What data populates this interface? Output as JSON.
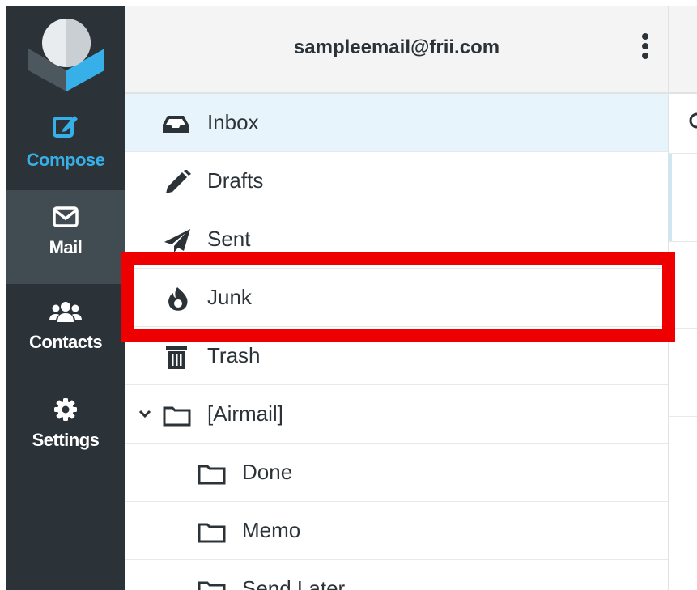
{
  "nav": {
    "compose": {
      "label": "Compose",
      "icon": "compose-icon"
    },
    "mail": {
      "label": "Mail",
      "icon": "envelope-icon"
    },
    "contacts": {
      "label": "Contacts",
      "icon": "users-icon"
    },
    "settings": {
      "label": "Settings",
      "icon": "gear-icon"
    }
  },
  "header": {
    "account": "sampleemail@frii.com",
    "menu_icon": "kebab-menu-icon"
  },
  "folders": [
    {
      "name": "Inbox",
      "icon": "inbox-icon",
      "active": true
    },
    {
      "name": "Drafts",
      "icon": "pencil-icon"
    },
    {
      "name": "Sent",
      "icon": "paper-plane-icon"
    },
    {
      "name": "Junk",
      "icon": "fire-icon"
    },
    {
      "name": "Trash",
      "icon": "trash-icon"
    },
    {
      "name": "[Airmail]",
      "icon": "folder-icon",
      "expanded": true
    },
    {
      "name": "Done",
      "icon": "folder-icon"
    },
    {
      "name": "Memo",
      "icon": "folder-icon"
    },
    {
      "name": "Send Later",
      "icon": "folder-icon"
    }
  ],
  "colors": {
    "nav_bg": "#2c3338",
    "nav_active_bg": "#414b52",
    "accent": "#37b0ea",
    "active_folder_bg": "#e8f4fb",
    "highlight": "#ee0000"
  }
}
